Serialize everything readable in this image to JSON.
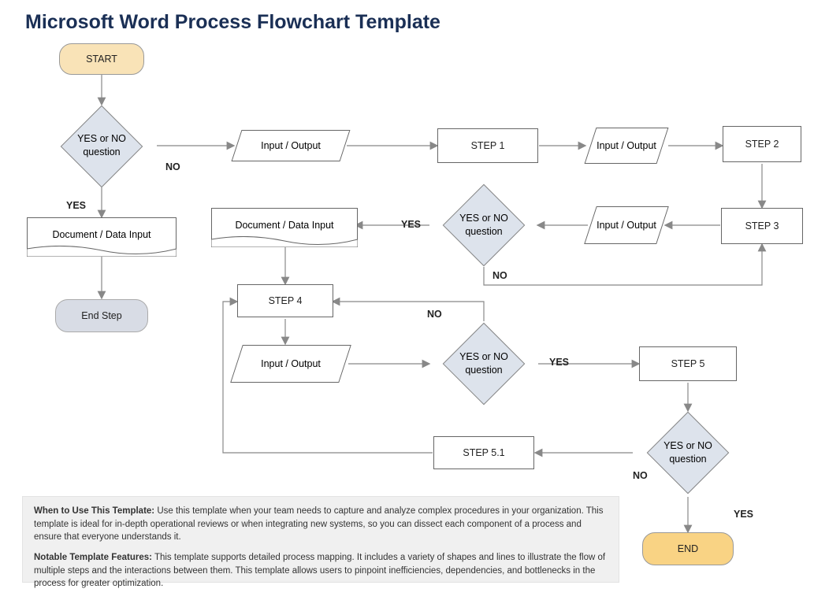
{
  "title": "Microsoft Word Process Flowchart Template",
  "nodes": {
    "start": "START",
    "q1": "YES or NO question",
    "io1": "Input / Output",
    "step1": "STEP 1",
    "io2": "Input / Output",
    "step2": "STEP 2",
    "step3": "STEP 3",
    "io3": "Input / Output",
    "q2": "YES or NO question",
    "doc1": "Document / Data Input",
    "doc2": "Document / Data Input",
    "endstep": "End Step",
    "step4": "STEP 4",
    "io4": "Input / Output",
    "q3": "YES or NO question",
    "step5": "STEP 5",
    "q4": "YES or NO question",
    "step51": "STEP 5.1",
    "end": "END"
  },
  "labels": {
    "yes": "YES",
    "no": "NO"
  },
  "description": {
    "p1_bold": "When to Use This Template:",
    "p1_text": " Use this template when your team needs to capture and analyze complex procedures in your organization. This template is ideal for in-depth operational reviews or when integrating new systems, so you can dissect each component of a process and ensure that everyone understands it.",
    "p2_bold": "Notable Template Features:",
    "p2_text": " This template supports detailed process mapping. It includes a variety of shapes and lines to illustrate the flow of multiple steps and the interactions between them. This template allows users to pinpoint inefficiencies, dependencies, and bottlenecks in the process for greater optimization."
  },
  "chart_data": {
    "type": "flowchart",
    "nodes": [
      {
        "id": "start",
        "type": "terminator",
        "label": "START"
      },
      {
        "id": "q1",
        "type": "decision",
        "label": "YES or NO question"
      },
      {
        "id": "io1",
        "type": "io",
        "label": "Input / Output"
      },
      {
        "id": "step1",
        "type": "process",
        "label": "STEP 1"
      },
      {
        "id": "io2",
        "type": "io",
        "label": "Input / Output"
      },
      {
        "id": "step2",
        "type": "process",
        "label": "STEP 2"
      },
      {
        "id": "step3",
        "type": "process",
        "label": "STEP 3"
      },
      {
        "id": "io3",
        "type": "io",
        "label": "Input / Output"
      },
      {
        "id": "q2",
        "type": "decision",
        "label": "YES or NO question"
      },
      {
        "id": "doc1",
        "type": "document",
        "label": "Document / Data Input"
      },
      {
        "id": "doc2",
        "type": "document",
        "label": "Document / Data Input"
      },
      {
        "id": "endstep",
        "type": "terminator",
        "label": "End Step"
      },
      {
        "id": "step4",
        "type": "process",
        "label": "STEP 4"
      },
      {
        "id": "io4",
        "type": "io",
        "label": "Input / Output"
      },
      {
        "id": "q3",
        "type": "decision",
        "label": "YES or NO question"
      },
      {
        "id": "step5",
        "type": "process",
        "label": "STEP 5"
      },
      {
        "id": "q4",
        "type": "decision",
        "label": "YES or NO question"
      },
      {
        "id": "step51",
        "type": "process",
        "label": "STEP 5.1"
      },
      {
        "id": "end",
        "type": "terminator",
        "label": "END"
      }
    ],
    "edges": [
      {
        "from": "start",
        "to": "q1"
      },
      {
        "from": "q1",
        "to": "doc1",
        "label": "YES"
      },
      {
        "from": "q1",
        "to": "io1",
        "label": "NO"
      },
      {
        "from": "doc1",
        "to": "endstep"
      },
      {
        "from": "io1",
        "to": "step1"
      },
      {
        "from": "step1",
        "to": "io2"
      },
      {
        "from": "io2",
        "to": "step2"
      },
      {
        "from": "step2",
        "to": "step3"
      },
      {
        "from": "step3",
        "to": "io3"
      },
      {
        "from": "io3",
        "to": "q2"
      },
      {
        "from": "q2",
        "to": "doc2",
        "label": "YES"
      },
      {
        "from": "q2",
        "to": "step3",
        "label": "NO"
      },
      {
        "from": "doc2",
        "to": "step4"
      },
      {
        "from": "step4",
        "to": "io4"
      },
      {
        "from": "io4",
        "to": "q3"
      },
      {
        "from": "q3",
        "to": "step5",
        "label": "YES"
      },
      {
        "from": "q3",
        "to": "step4",
        "label": "NO"
      },
      {
        "from": "step5",
        "to": "q4"
      },
      {
        "from": "q4",
        "to": "end",
        "label": "YES"
      },
      {
        "from": "q4",
        "to": "step51",
        "label": "NO"
      },
      {
        "from": "step51",
        "to": "step4"
      }
    ]
  }
}
